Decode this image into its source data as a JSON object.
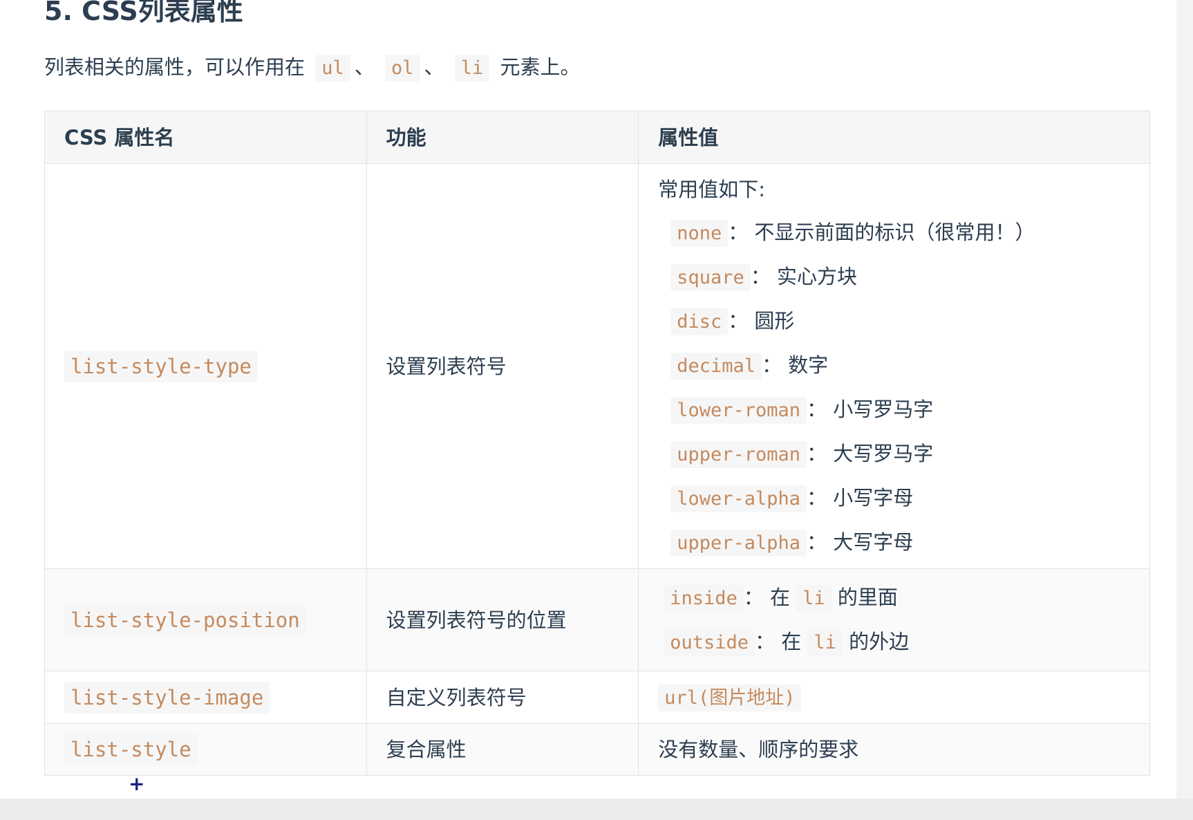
{
  "heading": "5. CSS列表属性",
  "intro": {
    "before": "列表相关的属性，可以作用在",
    "tags": [
      "ul",
      "ol",
      "li"
    ],
    "sep": "、",
    "after": "元素上。"
  },
  "table": {
    "headers": [
      "CSS 属性名",
      "功能",
      "属性值"
    ],
    "row1": {
      "prop": "list-style-type",
      "func": "设置列表符号",
      "intro": "常用值如下:",
      "items": [
        {
          "code": "none",
          "text": "：  不显示前面的标识（很常用！）"
        },
        {
          "code": "square",
          "text": "：  实心方块"
        },
        {
          "code": "disc",
          "text": "：  圆形"
        },
        {
          "code": "decimal",
          "text": "：  数字"
        },
        {
          "code": "lower-roman",
          "text": "：  小写罗马字"
        },
        {
          "code": "upper-roman",
          "text": "：  大写罗马字"
        },
        {
          "code": "lower-alpha",
          "text": "：  小写字母"
        },
        {
          "code": "upper-alpha",
          "text": "：  大写字母"
        }
      ]
    },
    "row2": {
      "prop": "list-style-position",
      "func": "设置列表符号的位置",
      "items": [
        {
          "code": "inside",
          "text1": "：  在 ",
          "code2": "li",
          "text2": " 的里面"
        },
        {
          "code": "outside",
          "text1": "：  在 ",
          "code2": "li",
          "text2": " 的外边"
        }
      ]
    },
    "row3": {
      "prop": "list-style-image",
      "func": "自定义列表符号",
      "value": "url(图片地址)"
    },
    "row4": {
      "prop": "list-style",
      "func": "复合属性",
      "value": "没有数量、顺序的要求"
    }
  },
  "cursor": "+"
}
